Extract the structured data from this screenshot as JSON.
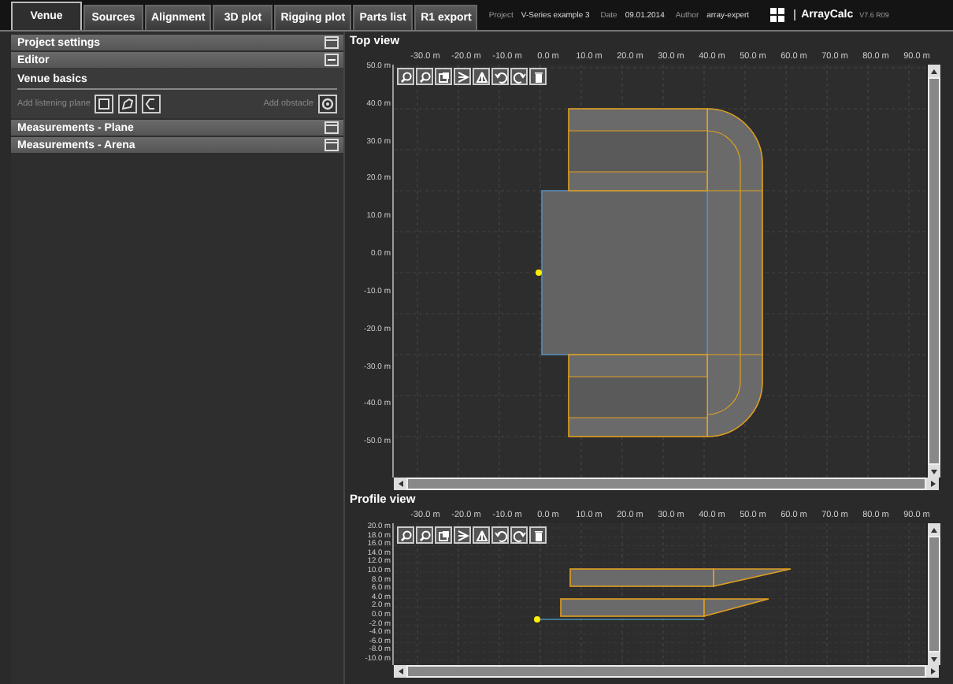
{
  "tabs": [
    {
      "label": "Venue",
      "selected": true
    },
    {
      "label": "Sources",
      "selected": false
    },
    {
      "label": "Alignment",
      "selected": false
    },
    {
      "label": "3D plot",
      "selected": false
    },
    {
      "label": "Rigging plot",
      "selected": false
    },
    {
      "label": "Parts list",
      "selected": false
    },
    {
      "label": "R1 export",
      "selected": false
    }
  ],
  "project_info": [
    {
      "label": "Project",
      "value": "V-Series example 3"
    },
    {
      "label": "Date",
      "value": "09.01.2014"
    },
    {
      "label": "Author",
      "value": "array-expert"
    }
  ],
  "brand": {
    "name": "ArrayCalc",
    "version": "V7.6 R09"
  },
  "sections": [
    {
      "title": "Project settings",
      "expanded": false
    },
    {
      "title": "Editor",
      "expanded": true,
      "subtitle": "Venue basics",
      "add_plane_label": "Add listening plane",
      "add_obstacle_label": "Add obstacle"
    },
    {
      "title": "Measurements - Plane",
      "expanded": false
    },
    {
      "title": "Measurements - Arena",
      "expanded": false
    }
  ],
  "top_view": {
    "title": "Top view",
    "x_ticks": [
      "-30.0 m",
      "-20.0 m",
      "-10.0 m",
      "0.0 m",
      "10.0 m",
      "20.0 m",
      "30.0 m",
      "40.0 m",
      "50.0 m",
      "60.0 m",
      "70.0 m",
      "80.0 m",
      "90.0 m"
    ],
    "y_ticks": [
      "50.0 m",
      "40.0 m",
      "30.0 m",
      "20.0 m",
      "10.0 m",
      "0.0 m",
      "-10.0 m",
      "-20.0 m",
      "-30.0 m",
      "-40.0 m",
      "-50.0 m"
    ]
  },
  "profile_view": {
    "title": "Profile view",
    "x_ticks": [
      "-30.0 m",
      "-20.0 m",
      "-10.0 m",
      "0.0 m",
      "10.0 m",
      "20.0 m",
      "30.0 m",
      "40.0 m",
      "50.0 m",
      "60.0 m",
      "70.0 m",
      "80.0 m",
      "90.0 m"
    ],
    "y_ticks": [
      "20.0 m",
      "18.0 m",
      "16.0 m",
      "14.0 m",
      "12.0 m",
      "10.0 m",
      "8.0 m",
      "6.0 m",
      "4.0 m",
      "2.0 m",
      "0.0 m",
      "-2.0 m",
      "-4.0 m",
      "-6.0 m",
      "-8.0 m",
      "-10.0 m"
    ]
  }
}
